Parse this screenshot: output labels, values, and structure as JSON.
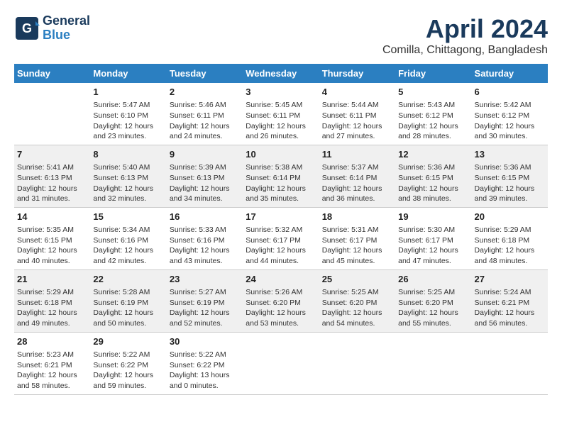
{
  "header": {
    "logo_line1": "General",
    "logo_line2": "Blue",
    "main_title": "April 2024",
    "subtitle": "Comilla, Chittagong, Bangladesh"
  },
  "weekdays": [
    "Sunday",
    "Monday",
    "Tuesday",
    "Wednesday",
    "Thursday",
    "Friday",
    "Saturday"
  ],
  "weeks": [
    [
      {
        "day": "",
        "info": ""
      },
      {
        "day": "1",
        "info": "Sunrise: 5:47 AM\nSunset: 6:10 PM\nDaylight: 12 hours\nand 23 minutes."
      },
      {
        "day": "2",
        "info": "Sunrise: 5:46 AM\nSunset: 6:11 PM\nDaylight: 12 hours\nand 24 minutes."
      },
      {
        "day": "3",
        "info": "Sunrise: 5:45 AM\nSunset: 6:11 PM\nDaylight: 12 hours\nand 26 minutes."
      },
      {
        "day": "4",
        "info": "Sunrise: 5:44 AM\nSunset: 6:11 PM\nDaylight: 12 hours\nand 27 minutes."
      },
      {
        "day": "5",
        "info": "Sunrise: 5:43 AM\nSunset: 6:12 PM\nDaylight: 12 hours\nand 28 minutes."
      },
      {
        "day": "6",
        "info": "Sunrise: 5:42 AM\nSunset: 6:12 PM\nDaylight: 12 hours\nand 30 minutes."
      }
    ],
    [
      {
        "day": "7",
        "info": "Sunrise: 5:41 AM\nSunset: 6:13 PM\nDaylight: 12 hours\nand 31 minutes."
      },
      {
        "day": "8",
        "info": "Sunrise: 5:40 AM\nSunset: 6:13 PM\nDaylight: 12 hours\nand 32 minutes."
      },
      {
        "day": "9",
        "info": "Sunrise: 5:39 AM\nSunset: 6:13 PM\nDaylight: 12 hours\nand 34 minutes."
      },
      {
        "day": "10",
        "info": "Sunrise: 5:38 AM\nSunset: 6:14 PM\nDaylight: 12 hours\nand 35 minutes."
      },
      {
        "day": "11",
        "info": "Sunrise: 5:37 AM\nSunset: 6:14 PM\nDaylight: 12 hours\nand 36 minutes."
      },
      {
        "day": "12",
        "info": "Sunrise: 5:36 AM\nSunset: 6:15 PM\nDaylight: 12 hours\nand 38 minutes."
      },
      {
        "day": "13",
        "info": "Sunrise: 5:36 AM\nSunset: 6:15 PM\nDaylight: 12 hours\nand 39 minutes."
      }
    ],
    [
      {
        "day": "14",
        "info": "Sunrise: 5:35 AM\nSunset: 6:15 PM\nDaylight: 12 hours\nand 40 minutes."
      },
      {
        "day": "15",
        "info": "Sunrise: 5:34 AM\nSunset: 6:16 PM\nDaylight: 12 hours\nand 42 minutes."
      },
      {
        "day": "16",
        "info": "Sunrise: 5:33 AM\nSunset: 6:16 PM\nDaylight: 12 hours\nand 43 minutes."
      },
      {
        "day": "17",
        "info": "Sunrise: 5:32 AM\nSunset: 6:17 PM\nDaylight: 12 hours\nand 44 minutes."
      },
      {
        "day": "18",
        "info": "Sunrise: 5:31 AM\nSunset: 6:17 PM\nDaylight: 12 hours\nand 45 minutes."
      },
      {
        "day": "19",
        "info": "Sunrise: 5:30 AM\nSunset: 6:17 PM\nDaylight: 12 hours\nand 47 minutes."
      },
      {
        "day": "20",
        "info": "Sunrise: 5:29 AM\nSunset: 6:18 PM\nDaylight: 12 hours\nand 48 minutes."
      }
    ],
    [
      {
        "day": "21",
        "info": "Sunrise: 5:29 AM\nSunset: 6:18 PM\nDaylight: 12 hours\nand 49 minutes."
      },
      {
        "day": "22",
        "info": "Sunrise: 5:28 AM\nSunset: 6:19 PM\nDaylight: 12 hours\nand 50 minutes."
      },
      {
        "day": "23",
        "info": "Sunrise: 5:27 AM\nSunset: 6:19 PM\nDaylight: 12 hours\nand 52 minutes."
      },
      {
        "day": "24",
        "info": "Sunrise: 5:26 AM\nSunset: 6:20 PM\nDaylight: 12 hours\nand 53 minutes."
      },
      {
        "day": "25",
        "info": "Sunrise: 5:25 AM\nSunset: 6:20 PM\nDaylight: 12 hours\nand 54 minutes."
      },
      {
        "day": "26",
        "info": "Sunrise: 5:25 AM\nSunset: 6:20 PM\nDaylight: 12 hours\nand 55 minutes."
      },
      {
        "day": "27",
        "info": "Sunrise: 5:24 AM\nSunset: 6:21 PM\nDaylight: 12 hours\nand 56 minutes."
      }
    ],
    [
      {
        "day": "28",
        "info": "Sunrise: 5:23 AM\nSunset: 6:21 PM\nDaylight: 12 hours\nand 58 minutes."
      },
      {
        "day": "29",
        "info": "Sunrise: 5:22 AM\nSunset: 6:22 PM\nDaylight: 12 hours\nand 59 minutes."
      },
      {
        "day": "30",
        "info": "Sunrise: 5:22 AM\nSunset: 6:22 PM\nDaylight: 13 hours\nand 0 minutes."
      },
      {
        "day": "",
        "info": ""
      },
      {
        "day": "",
        "info": ""
      },
      {
        "day": "",
        "info": ""
      },
      {
        "day": "",
        "info": ""
      }
    ]
  ]
}
